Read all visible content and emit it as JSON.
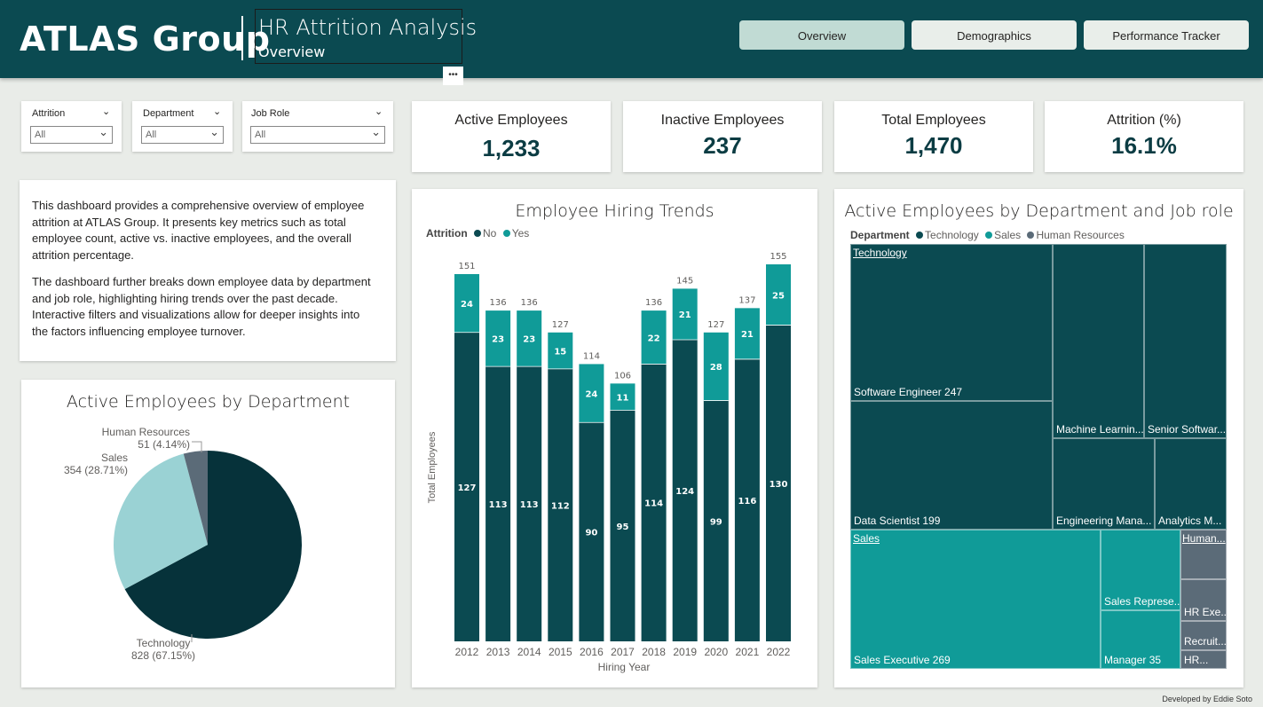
{
  "header": {
    "logo": "ATLAS Group",
    "title": "HR Attrition Analysis",
    "subtitle": "Overview",
    "more": "•••",
    "nav": [
      {
        "label": "Overview",
        "active": true
      },
      {
        "label": "Demographics",
        "active": false
      },
      {
        "label": "Performance Tracker",
        "active": false
      }
    ]
  },
  "slicers": [
    {
      "title": "Attrition",
      "value": "All"
    },
    {
      "title": "Department",
      "value": "All"
    },
    {
      "title": "Job Role",
      "value": "All"
    }
  ],
  "kpis": [
    {
      "label": "Active Employees",
      "value": "1,233"
    },
    {
      "label": "Inactive Employees",
      "value": "237"
    },
    {
      "label": "Total Employees",
      "value": "1,470"
    },
    {
      "label": "Attrition (%)",
      "value": "16.1%"
    }
  ],
  "description": {
    "p1": "This dashboard provides a comprehensive overview of employee attrition at ATLAS Group. It presents key metrics such as total employee count, active vs. inactive employees, and the overall attrition percentage.",
    "p2": "The dashboard further breaks down employee data by department and job role, highlighting hiring trends over the past decade.  Interactive filters and visualizations allow for deeper insights into the factors influencing employee turnover."
  },
  "footer": {
    "credit": "Developed by Eddie Soto"
  },
  "colors": {
    "header_bg": "#0b4a51",
    "no": "#0b4a51",
    "yes": "#109b98",
    "technology": "#0b4a51",
    "sales": "#109b98",
    "human_resources": "#5b6b78",
    "pie_technology": "#06323a",
    "pie_sales": "#9ad2d4",
    "pie_hr": "#5b6b78"
  },
  "chart_data": [
    {
      "type": "pie",
      "title": "Active Employees by Department",
      "slices": [
        {
          "label": "Technology",
          "value": 828,
          "display": "828 (67.15%)"
        },
        {
          "label": "Sales",
          "value": 354,
          "display": "354 (28.71%)"
        },
        {
          "label": "Human Resources",
          "value": 51,
          "display": "51 (4.14%)"
        }
      ]
    },
    {
      "type": "bar",
      "stacked": true,
      "title": "Employee Hiring Trends",
      "legend_title": "Attrition",
      "xlabel": "Hiring Year",
      "ylabel": "Total Employees",
      "categories": [
        "2012",
        "2013",
        "2014",
        "2015",
        "2016",
        "2017",
        "2018",
        "2019",
        "2020",
        "2021",
        "2022"
      ],
      "series": [
        {
          "name": "No",
          "values": [
            127,
            113,
            113,
            112,
            90,
            95,
            114,
            124,
            99,
            116,
            130
          ]
        },
        {
          "name": "Yes",
          "values": [
            24,
            23,
            23,
            15,
            24,
            11,
            22,
            21,
            28,
            21,
            25
          ]
        }
      ],
      "totals": [
        151,
        136,
        136,
        127,
        114,
        106,
        136,
        145,
        127,
        137,
        155
      ],
      "ylim": [
        0,
        155
      ]
    },
    {
      "type": "treemap",
      "title": "Active Employees by Department and Job role",
      "legend_title": "Department",
      "legend": [
        "Technology",
        "Sales",
        "Human Resources"
      ],
      "groups": [
        {
          "name": "Technology",
          "items": [
            {
              "label": "Software Engineer 247",
              "value": 247
            },
            {
              "label": "Data Scientist 199",
              "value": 199
            },
            {
              "label": "Machine Learnin...",
              "value": 0
            },
            {
              "label": "Senior Softwar...",
              "value": 0
            },
            {
              "label": "Engineering Mana...",
              "value": 0
            },
            {
              "label": "Analytics M...",
              "value": 0
            }
          ]
        },
        {
          "name": "Sales",
          "items": [
            {
              "label": "Sales Executive 269",
              "value": 269
            },
            {
              "label": "Sales Represe...",
              "value": 0
            },
            {
              "label": "Manager 35",
              "value": 35
            }
          ]
        },
        {
          "name": "Human...",
          "items": [
            {
              "label": "HR Exe...",
              "value": 0
            },
            {
              "label": "Recruit...",
              "value": 0
            },
            {
              "label": "HR...",
              "value": 0
            }
          ]
        }
      ]
    }
  ]
}
